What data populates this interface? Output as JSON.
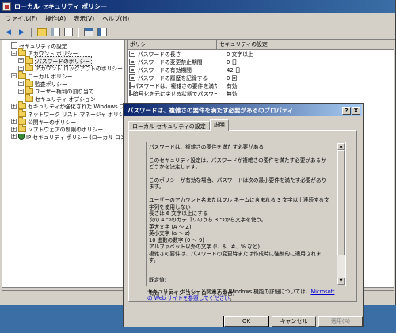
{
  "window": {
    "title": "ローカル セキュリティ ポリシー"
  },
  "menu": [
    "ファイル(F)",
    "操作(A)",
    "表示(V)",
    "ヘルプ(H)"
  ],
  "toolbar": {
    "icons": [
      "back-icon",
      "forward-icon",
      "up-folder-icon",
      "show-tree-icon",
      "properties-icon",
      "export-list-icon",
      "help-icon"
    ]
  },
  "tree": {
    "items": [
      {
        "label": "セキュリティの設定",
        "icon": "doc",
        "indent": 0,
        "expander": ""
      },
      {
        "label": "アカウント ポリシー",
        "icon": "folder",
        "indent": 1,
        "expander": "−"
      },
      {
        "label": "パスワードのポリシー",
        "icon": "folder",
        "indent": 2,
        "expander": "+",
        "selected": true
      },
      {
        "label": "アカウント ロックアウトのポリシー",
        "icon": "folder",
        "indent": 2,
        "expander": "+"
      },
      {
        "label": "ローカル ポリシー",
        "icon": "folder",
        "indent": 1,
        "expander": "−"
      },
      {
        "label": "監査ポリシー",
        "icon": "folder",
        "indent": 2,
        "expander": "+"
      },
      {
        "label": "ユーザー権利の割り当て",
        "icon": "folder",
        "indent": 2,
        "expander": "+"
      },
      {
        "label": "セキュリティ オプション",
        "icon": "folder",
        "indent": 2,
        "expander": ""
      },
      {
        "label": "セキュリティが強化された Windows ファイア",
        "icon": "folder",
        "indent": 1,
        "expander": "+"
      },
      {
        "label": "ネットワーク リスト マネージャ ポリシー",
        "icon": "folder",
        "indent": 1,
        "expander": ""
      },
      {
        "label": "公開キーのポリシー",
        "icon": "folder",
        "indent": 1,
        "expander": "+"
      },
      {
        "label": "ソフトウェアの制限のポリシー",
        "icon": "folder",
        "indent": 1,
        "expander": "+"
      },
      {
        "label": "IP セキュリティ ポリシー (ローカル コンピュー",
        "icon": "shield",
        "indent": 1,
        "expander": "+"
      }
    ]
  },
  "list": {
    "columns": [
      "ポリシー",
      "セキュリティの設定"
    ],
    "rows": [
      {
        "policy": "パスワードの長さ",
        "setting": "0 文字以上"
      },
      {
        "policy": "パスワードの変更禁止期間",
        "setting": "0 日"
      },
      {
        "policy": "パスワードの有効期間",
        "setting": "42 日"
      },
      {
        "policy": "パスワードの履歴を記録する",
        "setting": "0 回"
      },
      {
        "policy": "パスワードは、複雑さの要件を満た...",
        "setting": "有効"
      },
      {
        "policy": "暗号化を元に戻せる状態でパスワー...",
        "setting": "無効"
      }
    ]
  },
  "dialog": {
    "title": "パスワードは、複雑さの要件を満たす必要があるのプロパティ",
    "help_btn": "?",
    "close_btn": "X",
    "tabs": [
      "ローカル セキュリティの設定",
      "説明"
    ],
    "explanation": "パスワードは、複雑さの要件を満たす必要がある\n\nこのセキュリティ設定は、パスワードが複雑さの要件を満たす必要があるかどうかを決定します。\n\nこのポリシーが有効な場合、パスワードは次の最小要件を満たす必要があります。\n\nユーザーのアカウント名またはフル ネームに含まれる 3 文字以上連続する文字列を使用しない\n長さは 6 文字以上にする\n次の 4 つのカテゴリのうち 3 つから文字を使う。\n英大文字 (A ～ Z)\n英小文字 (a ～ z)\n10 進数の数字 (0 ～ 9)\nアルファベット以外の文字 (!、$、#、% など)\n複雑さの要件は、パスワードの変更時または作成時に強制的に適用されます。\n\n\n既定値:\n\n有効 (ドメイン コントローラの場合)",
    "related_text": "セキュリティ ポリシーと関連する Windows 機能の詳細については、",
    "related_link": "Microsoft の Web サイトを参照してください",
    "related_end": "。",
    "buttons": {
      "ok": "OK",
      "cancel": "キャンセル",
      "apply": "適用(A)"
    }
  }
}
